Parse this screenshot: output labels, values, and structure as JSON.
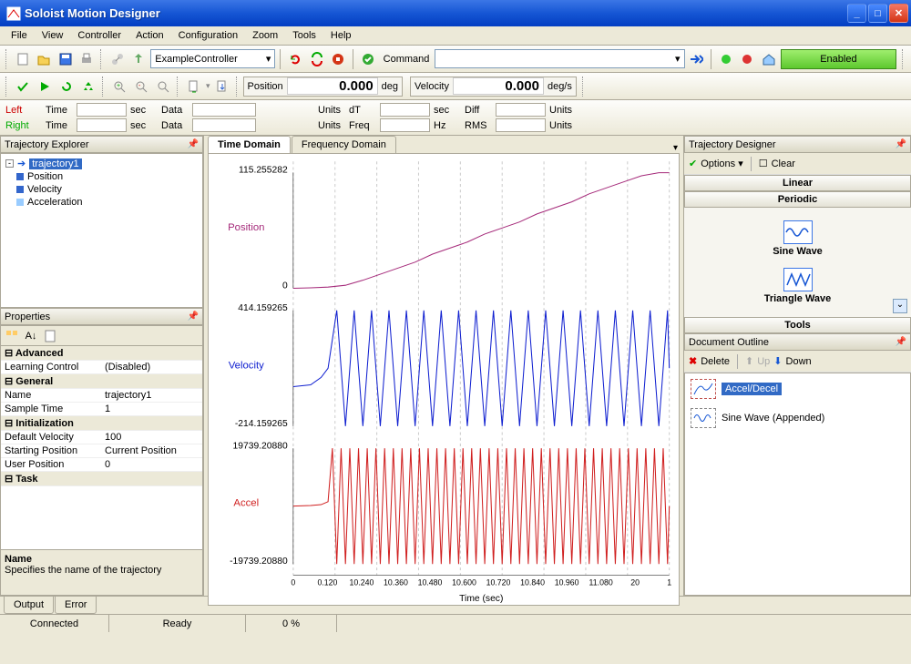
{
  "window": {
    "title": "Soloist Motion Designer"
  },
  "menu": [
    "File",
    "View",
    "Controller",
    "Action",
    "Configuration",
    "Zoom",
    "Tools",
    "Help"
  ],
  "toolbar1": {
    "controller_combo": "ExampleController",
    "command_label": "Command",
    "enabled_label": "Enabled"
  },
  "toolbar2": {
    "position_label": "Position",
    "position_value": "0.000",
    "position_unit": "deg",
    "velocity_label": "Velocity",
    "velocity_value": "0.000",
    "velocity_unit": "deg/s"
  },
  "info": {
    "left": "Left",
    "right": "Right",
    "time": "Time",
    "sec": "sec",
    "data": "Data",
    "units": "Units",
    "dt": "dT",
    "freq": "Freq",
    "hz": "Hz",
    "diff": "Diff",
    "rms": "RMS"
  },
  "trajectory_explorer": {
    "title": "Trajectory Explorer",
    "root": "trajectory1",
    "children": [
      "Position",
      "Velocity",
      "Acceleration"
    ]
  },
  "properties": {
    "title": "Properties",
    "categories": [
      {
        "name": "Advanced",
        "rows": [
          {
            "name": "Learning Control",
            "value": "(Disabled)"
          }
        ]
      },
      {
        "name": "General",
        "rows": [
          {
            "name": "Name",
            "value": "trajectory1"
          },
          {
            "name": "Sample Time",
            "value": "1"
          }
        ]
      },
      {
        "name": "Initialization",
        "rows": [
          {
            "name": "Default Velocity",
            "value": "100"
          },
          {
            "name": "Starting Position",
            "value": "Current Position"
          },
          {
            "name": "User Position",
            "value": "0"
          }
        ]
      },
      {
        "name": "Task",
        "rows": []
      }
    ],
    "desc_title": "Name",
    "desc_text": "Specifies the name of the trajectory"
  },
  "chart": {
    "tabs": [
      "Time Domain",
      "Frequency Domain"
    ],
    "xlabel": "Time (sec)",
    "panes": [
      {
        "label": "Position",
        "ymin_label": "0",
        "ymax_label": "115.255282",
        "color": "#a52a7a"
      },
      {
        "label": "Velocity",
        "ymin_label": "-214.159265",
        "ymax_label": "414.159265",
        "color": "#1020d0"
      },
      {
        "label": "Accel",
        "ymin_label": "-19739.20880",
        "ymax_label": "19739.20880",
        "color": "#d02020"
      }
    ],
    "xticks": [
      "0",
      "0.120",
      "10.240",
      "10.360",
      "10.480",
      "10.600",
      "10.720",
      "10.840",
      "10.960",
      "11.080",
      "20",
      "1"
    ]
  },
  "trajectory_designer": {
    "title": "Trajectory Designer",
    "options": "Options",
    "clear": "Clear",
    "linear": "Linear",
    "periodic": "Periodic",
    "tools": "Tools",
    "sine": "Sine Wave",
    "triangle": "Triangle Wave"
  },
  "document_outline": {
    "title": "Document Outline",
    "delete": "Delete",
    "up": "Up",
    "down": "Down",
    "items": [
      "Accel/Decel",
      "Sine Wave (Appended)"
    ]
  },
  "bottom_tabs": [
    "Output",
    "Error"
  ],
  "status": {
    "connected": "Connected",
    "ready": "Ready",
    "percent": "0 %"
  },
  "chart_data": {
    "type": "line",
    "xlabel": "Time (sec)",
    "xlim": [
      0,
      1.08
    ],
    "panes": [
      {
        "name": "Position",
        "color": "#a52a7a",
        "ylim": [
          0,
          115.255282
        ],
        "x": [
          0.0,
          0.05,
          0.1,
          0.15,
          0.2,
          0.25,
          0.3,
          0.35,
          0.4,
          0.45,
          0.5,
          0.55,
          0.6,
          0.65,
          0.7,
          0.75,
          0.8,
          0.85,
          0.9,
          0.95,
          1.0,
          1.05,
          1.08
        ],
        "values": [
          0,
          0.5,
          1.2,
          3,
          8,
          14,
          20,
          26,
          34,
          40,
          46,
          54,
          60,
          66,
          74,
          80,
          86,
          94,
          100,
          106,
          112,
          115,
          115
        ]
      },
      {
        "name": "Velocity",
        "color": "#1020d0",
        "ylim": [
          -214.159265,
          414.159265
        ],
        "x": [
          0.0,
          0.05,
          0.08,
          0.1,
          0.125,
          0.15,
          0.175,
          0.2,
          0.225,
          0.25,
          0.275,
          0.3,
          0.325,
          0.35,
          0.375,
          0.4,
          0.425,
          0.45,
          0.475,
          0.5,
          0.525,
          0.55,
          0.575,
          0.6,
          0.625,
          0.65,
          0.675,
          0.7,
          0.725,
          0.75,
          0.775,
          0.8,
          0.825,
          0.85,
          0.875,
          0.9,
          0.925,
          0.95,
          0.975,
          1.0,
          1.025,
          1.05,
          1.075,
          1.08
        ],
        "values": [
          0,
          10,
          50,
          100,
          414,
          -214,
          414,
          -214,
          414,
          -214,
          414,
          -214,
          414,
          -214,
          414,
          -214,
          414,
          -214,
          414,
          -214,
          414,
          -214,
          414,
          -214,
          414,
          -214,
          414,
          -214,
          414,
          -214,
          414,
          -214,
          414,
          -214,
          414,
          -214,
          414,
          -214,
          414,
          -214,
          414,
          -214,
          414,
          100
        ]
      },
      {
        "name": "Accel",
        "color": "#d02020",
        "ylim": [
          -19739.2088,
          19739.2088
        ],
        "x": [
          0.0,
          0.05,
          0.08,
          0.1,
          0.1125,
          0.125,
          0.1375,
          0.15,
          0.1625,
          0.175,
          0.1875,
          0.2,
          0.2125,
          0.225,
          0.2375,
          0.25,
          0.2625,
          0.275,
          0.2875,
          0.3,
          0.3125,
          0.325,
          0.3375,
          0.35,
          0.3625,
          0.375,
          0.3875,
          0.4,
          0.4125,
          0.425,
          0.4375,
          0.45,
          0.4625,
          0.475,
          0.4875,
          0.5,
          0.5125,
          0.525,
          0.5375,
          0.55,
          0.5625,
          0.575,
          0.5875,
          0.6,
          0.6125,
          0.625,
          0.6375,
          0.65,
          0.6625,
          0.675,
          0.6875,
          0.7,
          0.7125,
          0.725,
          0.7375,
          0.75,
          0.7625,
          0.775,
          0.7875,
          0.8,
          0.8125,
          0.825,
          0.8375,
          0.85,
          0.8625,
          0.875,
          0.8875,
          0.9,
          0.9125,
          0.925,
          0.9375,
          0.95,
          0.9625,
          0.975,
          0.9875,
          1.0,
          1.0125,
          1.025,
          1.0375,
          1.05,
          1.0625,
          1.075,
          1.08
        ],
        "values": [
          0,
          200,
          500,
          1500,
          19739,
          -19739,
          19739,
          -19739,
          19739,
          -19739,
          19739,
          -19739,
          19739,
          -19739,
          19739,
          -19739,
          19739,
          -19739,
          19739,
          -19739,
          19739,
          -19739,
          19739,
          -19739,
          19739,
          -19739,
          19739,
          -19739,
          19739,
          -19739,
          19739,
          -19739,
          19739,
          -19739,
          19739,
          -19739,
          19739,
          -19739,
          19739,
          -19739,
          19739,
          -19739,
          19739,
          -19739,
          19739,
          -19739,
          19739,
          -19739,
          19739,
          -19739,
          19739,
          -19739,
          19739,
          -19739,
          19739,
          -19739,
          19739,
          -19739,
          19739,
          -19739,
          19739,
          -19739,
          19739,
          -19739,
          19739,
          -19739,
          19739,
          -19739,
          19739,
          -19739,
          19739,
          -19739,
          19739,
          -19739,
          19739,
          -19739,
          19739,
          -19739,
          19739,
          -19739,
          19739,
          -19739,
          0
        ]
      }
    ]
  }
}
